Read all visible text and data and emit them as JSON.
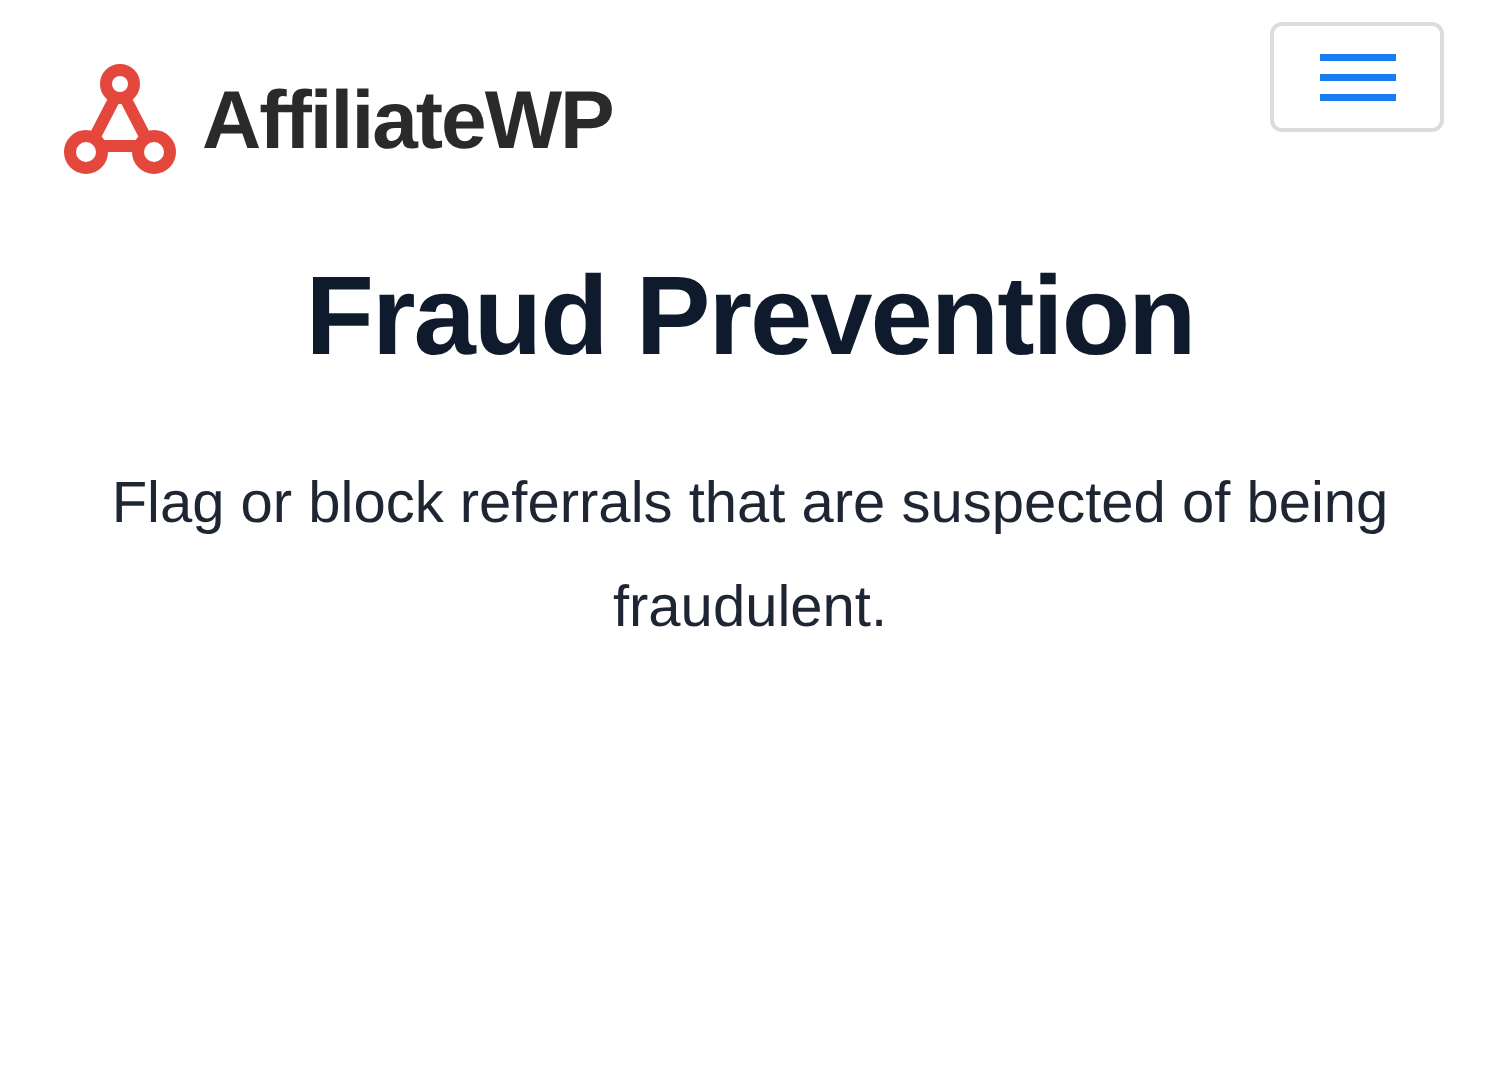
{
  "header": {
    "logo": {
      "text": "AffiliateWP"
    }
  },
  "hero": {
    "title": "Fraud Prevention",
    "description": "Flag or block referrals that are suspected of being fraudulent."
  }
}
